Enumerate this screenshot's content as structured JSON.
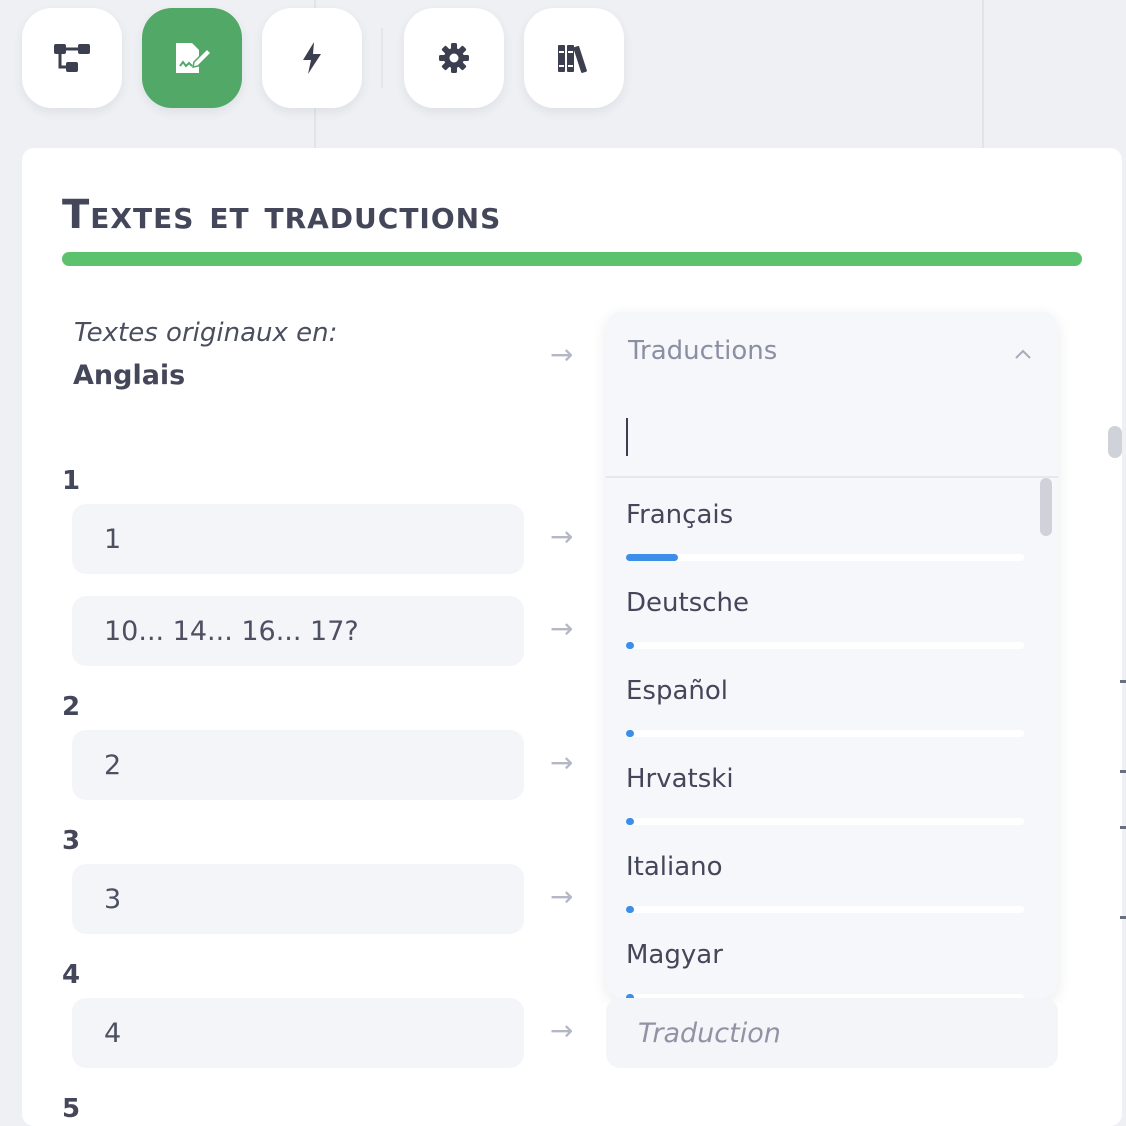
{
  "toolbar": {
    "tools": [
      {
        "name": "sitemap-icon",
        "active": false
      },
      {
        "name": "edit-text-icon",
        "active": true
      },
      {
        "name": "bolt-icon",
        "active": false
      },
      {
        "name": "gear-icon",
        "active": false
      },
      {
        "name": "books-icon",
        "active": false
      }
    ],
    "active_color": "#52a866"
  },
  "panel": {
    "title": "Textes et traductions",
    "accent_color": "#5cc26d",
    "original_label": "Textes originaux en:",
    "original_language": "Anglais"
  },
  "rows": [
    {
      "group": "1",
      "text": "1"
    },
    {
      "text": "10... 14... 16... 17?"
    },
    {
      "group": "2",
      "text": "2"
    },
    {
      "group": "3",
      "text": "3"
    },
    {
      "group": "4",
      "text": "4"
    },
    {
      "group": "5"
    }
  ],
  "arrow_glyph": "→",
  "dropdown": {
    "placeholder": "Traductions",
    "search_value": "",
    "options": [
      {
        "label": "Français",
        "progress": 0.13
      },
      {
        "label": "Deutsche",
        "progress": 0.02
      },
      {
        "label": "Español",
        "progress": 0.02
      },
      {
        "label": "Hrvatski",
        "progress": 0.02
      },
      {
        "label": "Italiano",
        "progress": 0.02
      },
      {
        "label": "Magyar",
        "progress": 0.02
      }
    ]
  },
  "translation_input": {
    "placeholder": "Traduction"
  },
  "colors": {
    "progress": "#3d8ee8",
    "background": "#eef0f4"
  }
}
